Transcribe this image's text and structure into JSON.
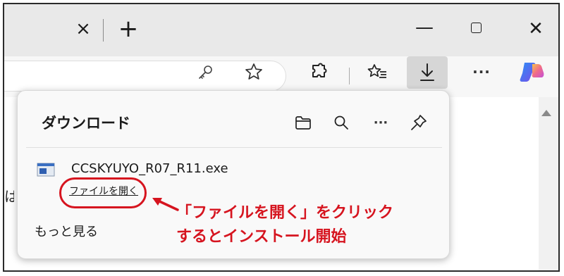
{
  "titlebar": {
    "tab_close_glyph": "×",
    "new_tab_glyph": "+",
    "minimize_glyph": "—",
    "close_glyph": "✕"
  },
  "toolbar": {
    "more_glyph": "···",
    "icons": [
      "key-icon",
      "star-icon",
      "extensions-icon",
      "favorites-icon",
      "download-icon",
      "more-icon",
      "copilot-icon"
    ]
  },
  "page": {
    "partial_text": "は依"
  },
  "download_panel": {
    "title": "ダウンロード",
    "more_glyph": "···",
    "file": {
      "name": "CCSKYUYO_R07_R11.exe",
      "action_label": "ファイルを開く"
    },
    "see_more_label": "もっと見る"
  },
  "annotation": {
    "line1": "「ファイルを開く」をクリック",
    "line2": "するとインストール開始",
    "color": "#d6141f"
  }
}
